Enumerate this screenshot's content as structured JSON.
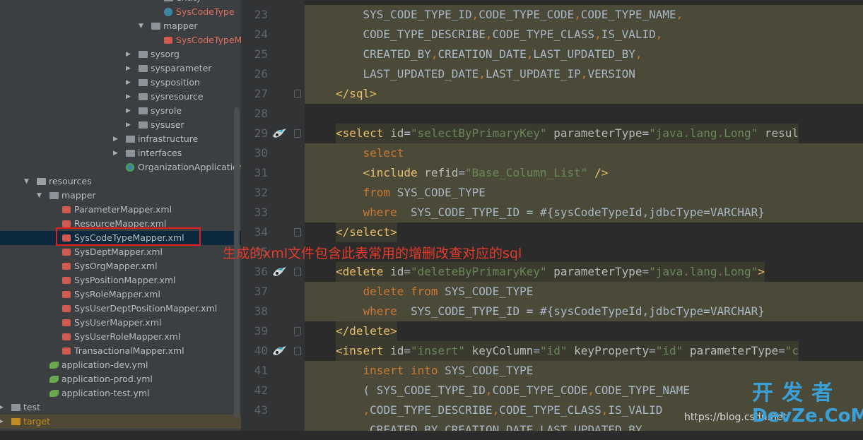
{
  "tree": [
    {
      "indent": 232,
      "type": "folder",
      "label": "entity",
      "arrow": "",
      "cut": true
    },
    {
      "indent": 232,
      "type": "cls",
      "label": "SysCodeType",
      "arrow": "",
      "err": true
    },
    {
      "indent": 214,
      "type": "folder",
      "label": "mapper",
      "arrow": "▼"
    },
    {
      "indent": 232,
      "type": "xml",
      "label": "SysCodeTypeMa",
      "arrow": "",
      "err": true
    },
    {
      "indent": 196,
      "type": "folder",
      "label": "sysorg",
      "arrow": "▶"
    },
    {
      "indent": 196,
      "type": "folder",
      "label": "sysparameter",
      "arrow": "▶"
    },
    {
      "indent": 196,
      "type": "folder",
      "label": "sysposition",
      "arrow": "▶"
    },
    {
      "indent": 196,
      "type": "folder",
      "label": "sysresource",
      "arrow": "▶"
    },
    {
      "indent": 196,
      "type": "folder",
      "label": "sysrole",
      "arrow": "▶"
    },
    {
      "indent": 196,
      "type": "folder",
      "label": "sysuser",
      "arrow": "▶"
    },
    {
      "indent": 178,
      "type": "folder",
      "label": "infrastructure",
      "arrow": "▶"
    },
    {
      "indent": 178,
      "type": "folder",
      "label": "interfaces",
      "arrow": "▶"
    },
    {
      "indent": 178,
      "type": "app",
      "label": "OrganizationApplication",
      "arrow": ""
    },
    {
      "indent": 52,
      "type": "folder",
      "label": "resources",
      "arrow": "▼"
    },
    {
      "indent": 70,
      "type": "folder",
      "label": "mapper",
      "arrow": "▼"
    },
    {
      "indent": 88,
      "type": "xml",
      "label": "ParameterMapper.xml",
      "arrow": ""
    },
    {
      "indent": 88,
      "type": "xml",
      "label": "ResourceMapper.xml",
      "arrow": ""
    },
    {
      "indent": 88,
      "type": "xml",
      "label": "SysCodeTypeMapper.xml",
      "arrow": "",
      "selected": true
    },
    {
      "indent": 88,
      "type": "xml",
      "label": "SysDeptMapper.xml",
      "arrow": ""
    },
    {
      "indent": 88,
      "type": "xml",
      "label": "SysOrgMapper.xml",
      "arrow": ""
    },
    {
      "indent": 88,
      "type": "xml",
      "label": "SysPositionMapper.xml",
      "arrow": ""
    },
    {
      "indent": 88,
      "type": "xml",
      "label": "SysRoleMapper.xml",
      "arrow": ""
    },
    {
      "indent": 88,
      "type": "xml",
      "label": "SysUserDeptPositionMapper.xml",
      "arrow": ""
    },
    {
      "indent": 88,
      "type": "xml",
      "label": "SysUserMapper.xml",
      "arrow": ""
    },
    {
      "indent": 88,
      "type": "xml",
      "label": "SysUserRoleMapper.xml",
      "arrow": ""
    },
    {
      "indent": 88,
      "type": "xml",
      "label": "TransactionalMapper.xml",
      "arrow": ""
    },
    {
      "indent": 70,
      "type": "yml",
      "label": "application-dev.yml",
      "arrow": ""
    },
    {
      "indent": 70,
      "type": "yml",
      "label": "application-prod.yml",
      "arrow": ""
    },
    {
      "indent": 70,
      "type": "yml",
      "label": "application-test.yml",
      "arrow": ""
    },
    {
      "indent": 16,
      "type": "folder",
      "label": "test",
      "arrow": "▶"
    },
    {
      "indent": 16,
      "type": "folder",
      "label": "target",
      "arrow": "▶",
      "target": true
    }
  ],
  "lines": [
    {
      "n": "23",
      "bg": [
        0,
        790
      ],
      "tokens": [
        [
          "    SYS_CODE_TYPE_ID",
          ""
        ],
        [
          ",",
          "kw"
        ],
        [
          "CODE_TYPE_CODE",
          ""
        ],
        [
          ",",
          "kw"
        ],
        [
          "CODE_TYPE_NAME",
          ""
        ],
        [
          ",",
          "kw"
        ]
      ]
    },
    {
      "n": "24",
      "bg": [
        0,
        790
      ],
      "tokens": [
        [
          "    CODE_TYPE_DESCRIBE",
          ""
        ],
        [
          ",",
          "kw"
        ],
        [
          "CODE_TYPE_CLASS",
          ""
        ],
        [
          ",",
          "kw"
        ],
        [
          "IS_VALID",
          ""
        ],
        [
          ",",
          "kw"
        ]
      ]
    },
    {
      "n": "25",
      "bg": [
        0,
        790
      ],
      "tokens": [
        [
          "    CREATED_BY",
          ""
        ],
        [
          ",",
          "kw"
        ],
        [
          "CREATION_DATE",
          ""
        ],
        [
          ",",
          "kw"
        ],
        [
          "LAST_UPDATED_BY",
          ""
        ],
        [
          ",",
          "kw"
        ]
      ]
    },
    {
      "n": "26",
      "bg": [
        0,
        790
      ],
      "tokens": [
        [
          "    LAST_UPDATED_DATE",
          ""
        ],
        [
          ",",
          "kw"
        ],
        [
          "LAST_UPDATE_IP",
          ""
        ],
        [
          ",",
          "kw"
        ],
        [
          "VERSION",
          ""
        ]
      ]
    },
    {
      "n": "27",
      "fold": true,
      "bg": [
        0,
        790
      ],
      "tokens": [
        [
          "</sql>",
          "tag"
        ]
      ]
    },
    {
      "n": "28",
      "tokens": []
    },
    {
      "n": "29",
      "fold": true,
      "icon": true,
      "tokens": [
        [
          "<select ",
          "tag"
        ],
        [
          "id",
          "attr"
        ],
        [
          "=",
          ""
        ],
        [
          "\"selectByPrimaryKey\"",
          "val"
        ],
        [
          " parameterType",
          "attr"
        ],
        [
          "=",
          ""
        ],
        [
          "\"java.lang.Long\"",
          "val"
        ],
        [
          " resul",
          "attr"
        ]
      ]
    },
    {
      "n": "30",
      "bg": [
        0,
        790
      ],
      "tokens": [
        [
          "    select",
          "kw"
        ]
      ]
    },
    {
      "n": "31",
      "bg": [
        0,
        790
      ],
      "tokens": [
        [
          "    ",
          ""
        ],
        [
          "<include ",
          "tag"
        ],
        [
          "refid",
          "attr"
        ],
        [
          "=",
          ""
        ],
        [
          "\"Base_Column_List\"",
          "val"
        ],
        [
          " />",
          "tag"
        ]
      ]
    },
    {
      "n": "32",
      "bg": [
        0,
        790
      ],
      "tokens": [
        [
          "    from",
          "kw"
        ],
        [
          " SYS_CODE_TYPE",
          ""
        ]
      ]
    },
    {
      "n": "33",
      "bg": [
        0,
        790
      ],
      "tokens": [
        [
          "    where",
          "kw"
        ],
        [
          "  SYS_CODE_TYPE_ID = #{sysCodeTypeId,jdbcType=VARCHAR}",
          ""
        ]
      ]
    },
    {
      "n": "34",
      "fold": true,
      "tokens": [
        [
          "</select>",
          "tag"
        ]
      ]
    },
    {
      "n": "35",
      "tokens": []
    },
    {
      "n": "36",
      "fold": true,
      "icon": true,
      "tokens": [
        [
          "<delete ",
          "tag"
        ],
        [
          "id",
          "attr"
        ],
        [
          "=",
          ""
        ],
        [
          "\"deleteByPrimaryKey\"",
          "val"
        ],
        [
          " parameterType",
          "attr"
        ],
        [
          "=",
          ""
        ],
        [
          "\"java.lang.Long\"",
          "val"
        ],
        [
          ">",
          "tag"
        ]
      ]
    },
    {
      "n": "37",
      "bg": [
        0,
        790
      ],
      "tokens": [
        [
          "    delete from",
          "kw"
        ],
        [
          " SYS_CODE_TYPE",
          ""
        ]
      ]
    },
    {
      "n": "38",
      "bg": [
        0,
        790
      ],
      "tokens": [
        [
          "    where",
          "kw"
        ],
        [
          "  SYS_CODE_TYPE_ID = #{sysCodeTypeId,jdbcType=VARCHAR}",
          ""
        ]
      ]
    },
    {
      "n": "39",
      "fold": true,
      "tokens": [
        [
          "</delete>",
          "tag"
        ]
      ]
    },
    {
      "n": "40",
      "fold": true,
      "icon": true,
      "tokens": [
        [
          "<insert ",
          "tag"
        ],
        [
          "id",
          "attr"
        ],
        [
          "=",
          ""
        ],
        [
          "\"insert\"",
          "val"
        ],
        [
          " keyColumn",
          "attr"
        ],
        [
          "=",
          ""
        ],
        [
          "\"id\"",
          "val"
        ],
        [
          " keyProperty",
          "attr"
        ],
        [
          "=",
          ""
        ],
        [
          "\"id\"",
          "val"
        ],
        [
          " parameterType",
          "attr"
        ],
        [
          "=",
          ""
        ],
        [
          "\"c",
          "val"
        ]
      ]
    },
    {
      "n": "41",
      "bg": [
        0,
        790
      ],
      "tokens": [
        [
          "    insert into",
          "kw"
        ],
        [
          " SYS_CODE_TYPE",
          ""
        ]
      ]
    },
    {
      "n": "42",
      "bg": [
        0,
        790
      ],
      "tokens": [
        [
          "    ( SYS_CODE_TYPE_ID",
          ""
        ],
        [
          ",",
          "kw"
        ],
        [
          "CODE_TYPE_CODE",
          ""
        ],
        [
          ",",
          "kw"
        ],
        [
          "CODE_TYPE_NAME",
          ""
        ]
      ]
    },
    {
      "n": "43",
      "bg": [
        0,
        790
      ],
      "tokens": [
        [
          "    ",
          ""
        ],
        [
          ",",
          "kw"
        ],
        [
          "CODE_TYPE_DESCRIBE",
          ""
        ],
        [
          ",",
          "kw"
        ],
        [
          "CODE_TYPE_CLASS",
          ""
        ],
        [
          ",",
          "kw"
        ],
        [
          "IS_VALID",
          ""
        ]
      ]
    },
    {
      "n": "",
      "bg": [
        0,
        790
      ],
      "tokens": [
        [
          "    ",
          ""
        ],
        [
          ",",
          "kw"
        ],
        [
          "CREATED_BY",
          ""
        ],
        [
          ",",
          "kw"
        ],
        [
          "CREATION_DATE",
          ""
        ],
        [
          ",",
          "kw"
        ],
        [
          "LAST_UPDATED_BY",
          ""
        ]
      ]
    }
  ],
  "annotation": "生成的xml文件包含此表常用的增删改查对应的sql",
  "watermark": {
    "url": "https://blog.csdn.net/",
    "logo_cn": "开发者",
    "logo_en": "DevZe.CoM"
  },
  "colors": {
    "editor_bg": "#2b2b2b",
    "code_block_bg": "#4b4a39",
    "tree_bg": "#3c3f41",
    "selection": "#0d293e",
    "annotation": "#e53a2a"
  }
}
